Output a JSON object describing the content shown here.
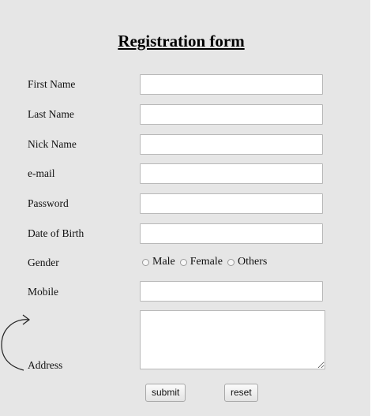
{
  "form": {
    "title": "Registration form",
    "fields": [
      {
        "label": "First Name",
        "value": ""
      },
      {
        "label": "Last Name",
        "value": ""
      },
      {
        "label": "Nick Name",
        "value": ""
      },
      {
        "label": "e-mail",
        "value": ""
      },
      {
        "label": "Password",
        "value": ""
      },
      {
        "label": "Date of Birth",
        "value": ""
      }
    ],
    "gender": {
      "label": "Gender",
      "options": [
        "Male",
        "Female",
        "Others"
      ]
    },
    "mobile": {
      "label": "Mobile",
      "value": ""
    },
    "address": {
      "label": "Address",
      "value": ""
    },
    "buttons": {
      "submit": "submit",
      "reset": "reset"
    }
  }
}
